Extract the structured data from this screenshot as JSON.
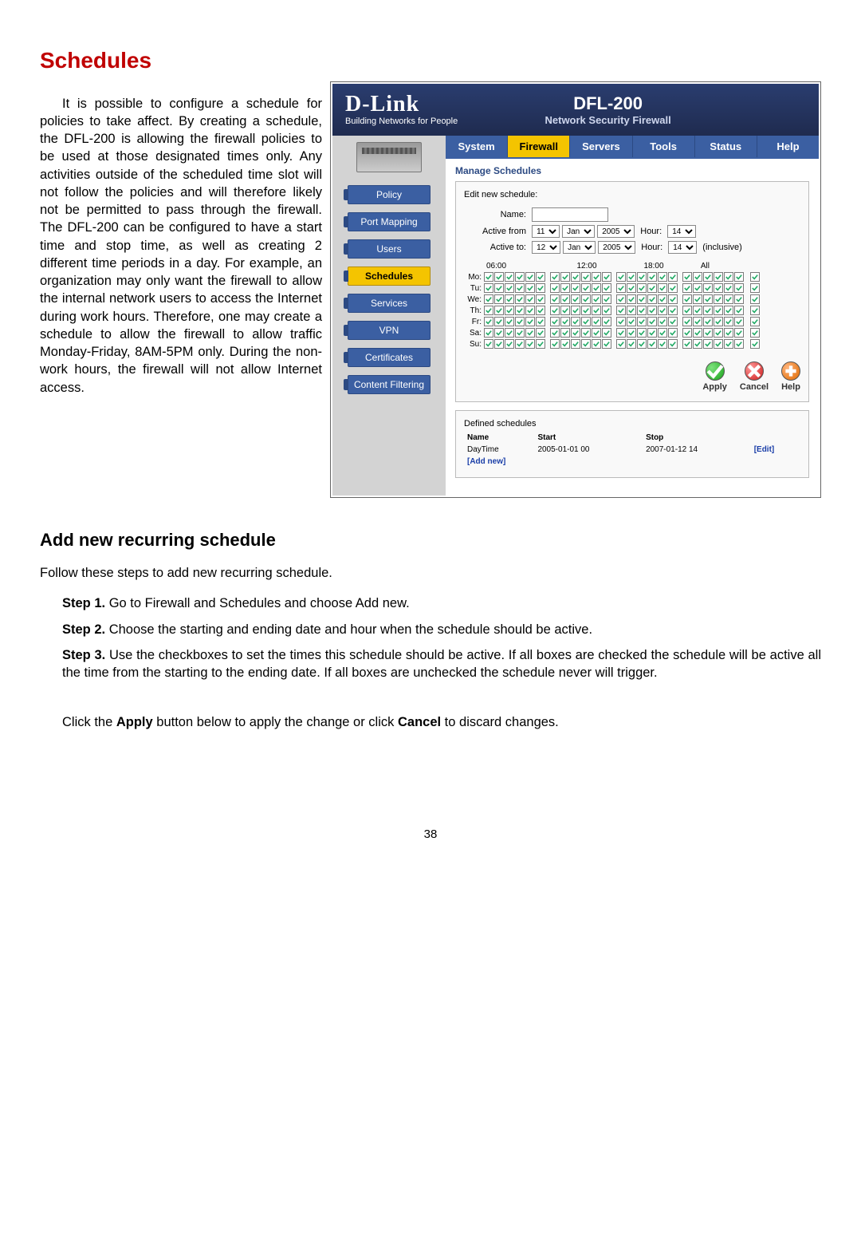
{
  "headings": {
    "schedules": "Schedules",
    "add_new": "Add new recurring schedule"
  },
  "text": {
    "intro_combined": "It is possible to configure a schedule for policies to take affect. By creating a schedule, the DFL-200 is allowing the firewall policies to be used at those designated times only. Any activities outside of the scheduled time slot will not follow the policies and will therefore likely not be permitted to pass through the firewall. The DFL-200 can be configured to have a start time and stop time, as well as creating 2 different time periods in a day. For example, an organization may only want the firewall to allow the internal network users to access the Internet during work hours. Therefore, one may create a schedule to allow the firewall to allow traffic Monday-Friday, 8AM-5PM only. During the non-work hours, the firewall will not allow Internet access.",
    "follow": "Follow these steps to add new recurring schedule.",
    "step1b": "Step 1.",
    "step1": " Go to Firewall and Schedules and choose Add new.",
    "step2b": "Step 2.",
    "step2": " Choose the starting and ending date and hour when the schedule should be active.",
    "step3b": "Step 3.",
    "step3": " Use the checkboxes to set the times this schedule should be active. If all boxes are checked the schedule will be active all the time from the starting to the ending date. If all boxes are unchecked the schedule never will trigger.",
    "apply_note_pre": "Click the ",
    "apply_b": "Apply",
    "apply_note_mid": " button below to apply the change or click ",
    "cancel_b": "Cancel",
    "apply_note_post": " to discard changes."
  },
  "screenshot": {
    "logo_main": "D-Link",
    "logo_sub": "Building Networks for People",
    "title_main": "DFL-200",
    "title_sub": "Network Security Firewall",
    "tabs": [
      "System",
      "Firewall",
      "Servers",
      "Tools",
      "Status",
      "Help"
    ],
    "active_tab": "Firewall",
    "sidebar": [
      "Policy",
      "Port Mapping",
      "Users",
      "Schedules",
      "Services",
      "VPN",
      "Certificates",
      "Content Filtering"
    ],
    "active_side": "Schedules",
    "manage_heading": "Manage Schedules",
    "edit_line": "Edit new schedule:",
    "labels": {
      "name": "Name:",
      "active_from": "Active from",
      "active_to": "Active to:",
      "hour": "Hour:",
      "inclusive": "(inclusive)"
    },
    "from": {
      "day": "11",
      "month": "Jan",
      "year": "2005",
      "hour": "14"
    },
    "to": {
      "day": "12",
      "month": "Jan",
      "year": "2005",
      "hour": "14"
    },
    "grid_headers": [
      "06:00",
      "12:00",
      "18:00",
      "All"
    ],
    "days": [
      "Mo:",
      "Tu:",
      "We:",
      "Th:",
      "Fr:",
      "Sa:",
      "Su:"
    ],
    "buttons": {
      "apply": "Apply",
      "cancel": "Cancel",
      "help": "Help"
    },
    "defined_heading": "Defined schedules",
    "defined_table": {
      "headers": [
        "Name",
        "Start",
        "Stop",
        ""
      ],
      "rows": [
        [
          "DayTime",
          "2005-01-01 00",
          "2007-01-12 14",
          "[Edit]"
        ]
      ],
      "add_new": "[Add new]"
    }
  },
  "page_number": "38"
}
